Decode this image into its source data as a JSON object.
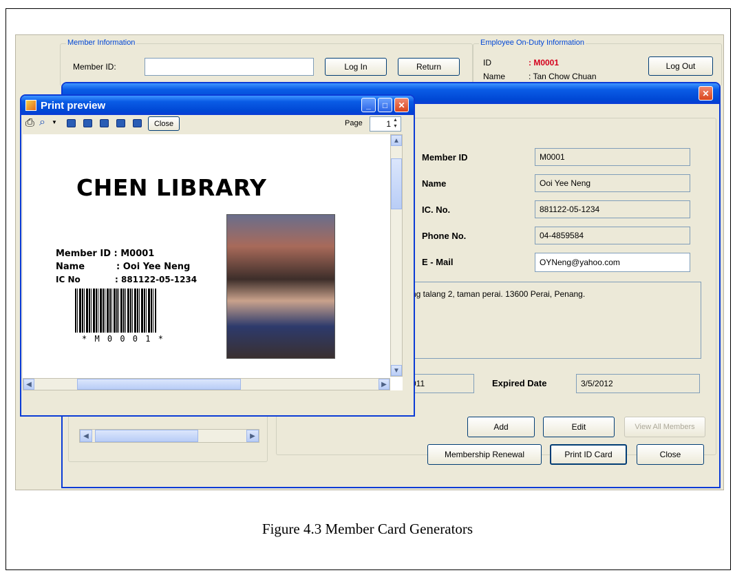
{
  "background": {
    "member_group_title": "Member Information",
    "member_id_label": "Member ID:",
    "login_button": "Log In",
    "return_button": "Return",
    "employee_group_title": "Employee On-Duty Information",
    "employee_id_label": "ID",
    "employee_id_value": ": M0001",
    "employee_name_label": "Name",
    "employee_name_value": ": Tan Chow Chuan",
    "logout_button": "Log Out"
  },
  "member_form": {
    "fields": [
      {
        "label": "Member ID",
        "value": "M0001"
      },
      {
        "label": "Name",
        "value": "Ooi Yee Neng"
      },
      {
        "label": "IC. No.",
        "value": "881122-05-1234"
      },
      {
        "label": "Phone No.",
        "value": "04-4859584"
      },
      {
        "label": "E - Mail",
        "value": "OYNeng@yahoo.com"
      }
    ],
    "address": "ng talang 2, taman perai. 13600 Perai, Penang.",
    "join_date_partial": "011",
    "expired_label": "Expired Date",
    "expired_value": "3/5/2012",
    "add_button": "Add",
    "edit_button": "Edit",
    "view_all_button": "View All Members",
    "renewal_button": "Membership Renewal",
    "print_button": "Print ID Card",
    "close_button": "Close",
    "close_x": "✕"
  },
  "print_preview": {
    "title": "Print preview",
    "close_button": "Close",
    "page_label": "Page",
    "page_value": "1",
    "card": {
      "library_name": "CHEN LIBRARY",
      "member_id_line": "Member ID : M0001",
      "name_label": "Name",
      "name_value": ": Ooi Yee Neng",
      "ic_label": "IC No",
      "ic_value": ": 881122-05-1234",
      "barcode_text": "* M 0 0 0 1 *"
    }
  },
  "caption": "Figure 4.3 Member Card Generators",
  "colors": {
    "xp_blue": "#0a3bd6",
    "accent_red": "#d4001c"
  }
}
